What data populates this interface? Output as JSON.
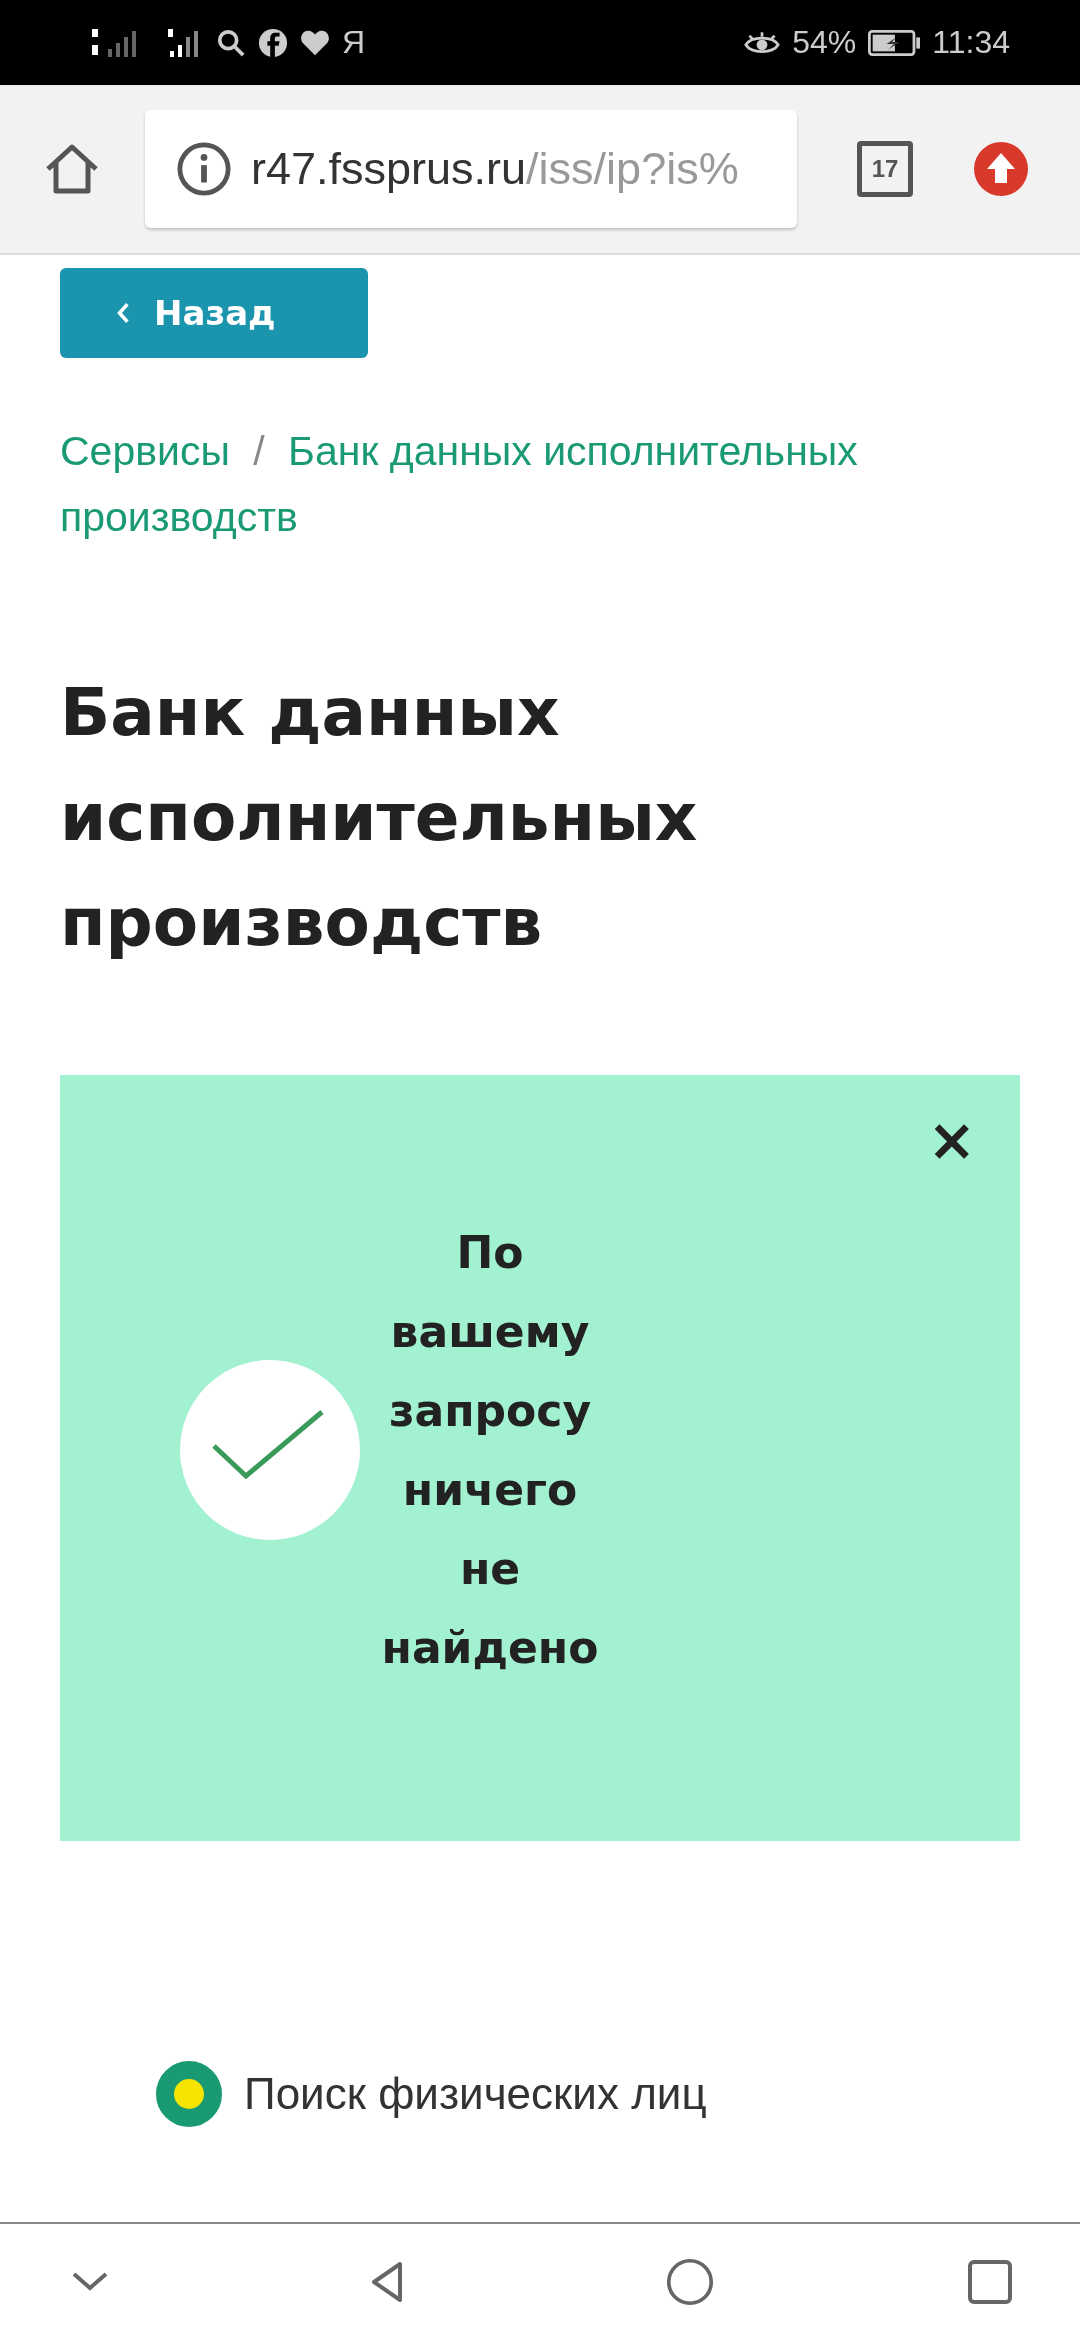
{
  "status_bar": {
    "app_letter": "Я",
    "battery": "54%",
    "time": "11:34"
  },
  "browser": {
    "url_host": "r47.fssprus.ru",
    "url_path": "/iss/ip?is%",
    "tab_count": "17"
  },
  "back_button": {
    "label": "Назад"
  },
  "breadcrumbs": [
    "Сервисы",
    "Банк данных исполнительных производств"
  ],
  "breadcrumb_separator": "/",
  "heading": "Банк данных исполнительных производств",
  "alert": {
    "close": "×",
    "message": "По вашему запросу ничего не найдено"
  },
  "search_options": [
    {
      "label": "Поиск физических лиц",
      "selected": true
    }
  ]
}
